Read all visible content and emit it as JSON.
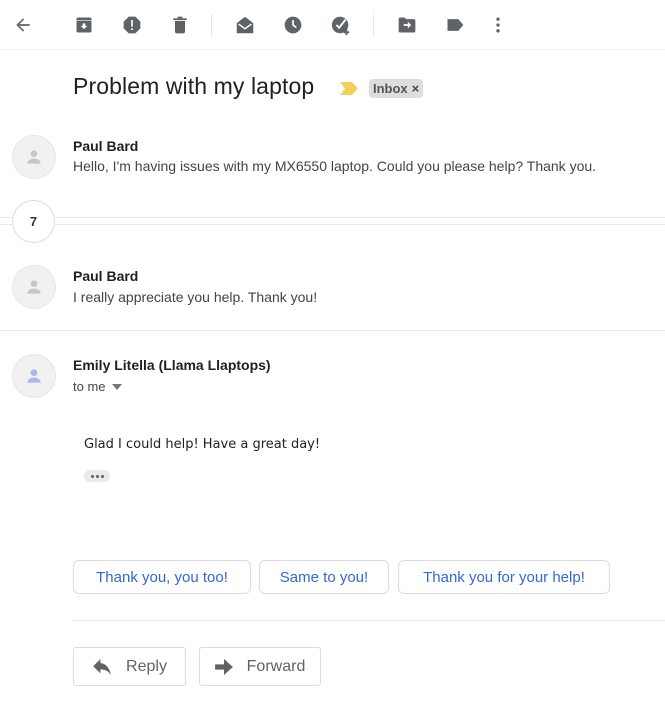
{
  "toolbar": {
    "icons": [
      "back-icon",
      "archive-icon",
      "report-spam-icon",
      "delete-icon",
      "mark-unread-icon",
      "snooze-icon",
      "add-to-tasks-icon",
      "move-to-icon",
      "label-icon",
      "more-options-icon"
    ]
  },
  "thread": {
    "subject": "Problem with my laptop",
    "label": "Inbox",
    "label_remove": "×",
    "collapsed_count": "7"
  },
  "messages": [
    {
      "sender": "Paul Bard",
      "snippet": "Hello, I'm having issues with my MX6550 laptop. Could you please help? Thank you."
    },
    {
      "sender": "Paul Bard",
      "snippet": "I really appreciate you help. Thank you!"
    },
    {
      "sender": "Emily Litella (Llama Llaptops)",
      "recipient": "to me",
      "body": "Glad I could help! Have a great day!"
    }
  ],
  "smart_replies": [
    "Thank you, you too!",
    "Same to you!",
    "Thank you for your help!"
  ],
  "actions": {
    "reply": "Reply",
    "forward": "Forward"
  },
  "colors": {
    "accent": "#3367d6",
    "important": "#f4cf5a",
    "icon": "#5f6368"
  }
}
